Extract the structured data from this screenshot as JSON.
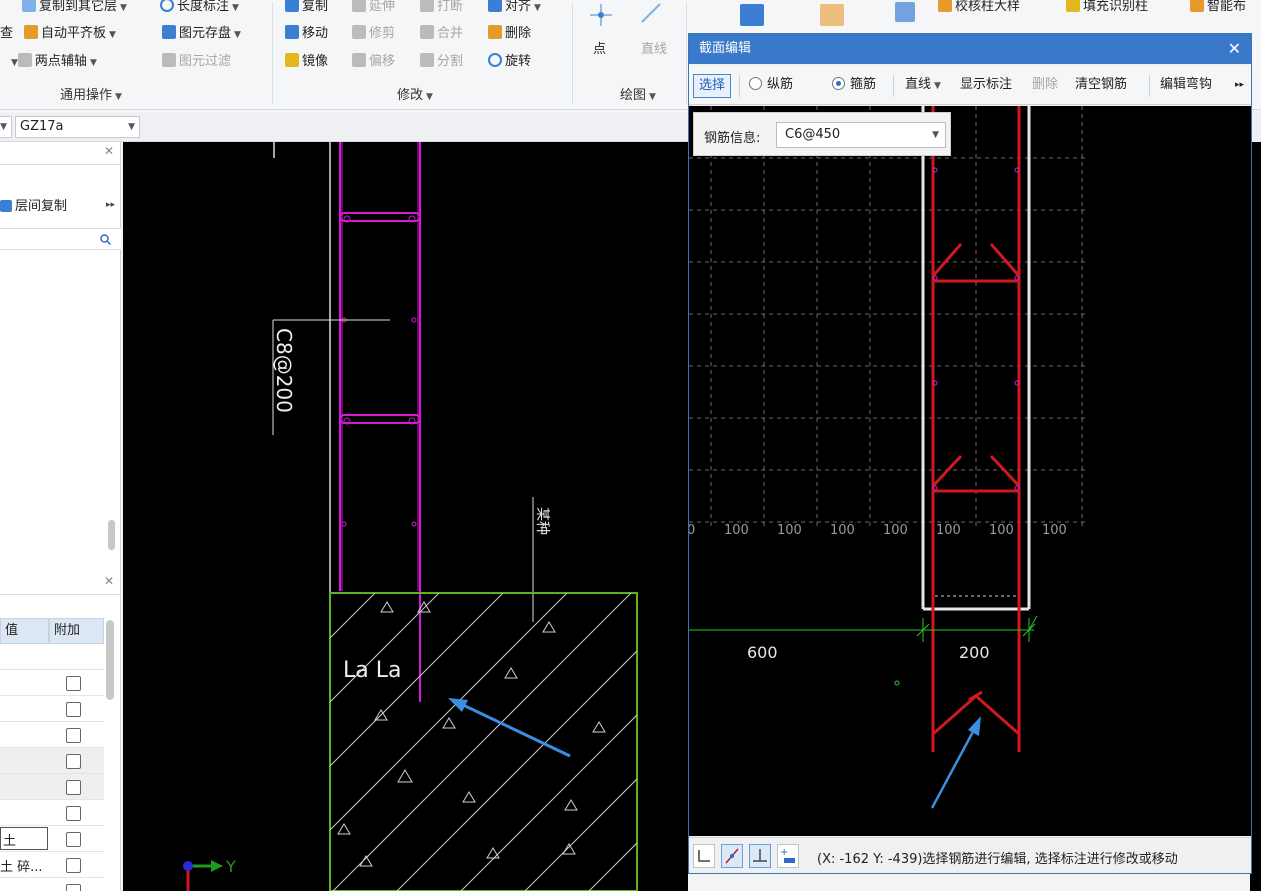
{
  "ribbon": {
    "items": {
      "copy_to_other_floors": "复制到其它层",
      "length_annotation": "长度标注",
      "copy": "复制",
      "extend": "延伸",
      "break": "打断",
      "align": "对齐",
      "check_column_detail": "校核柱大样",
      "fill_identify_column": "填充识别柱",
      "smart_layout": "智能布",
      "check": "查",
      "auto_flush_slab": "自动平齐板",
      "element_save": "图元存盘",
      "move": "移动",
      "trim": "修剪",
      "merge": "合并",
      "delete": "删除",
      "two_point_axis": "两点辅轴",
      "element_filter": "图元过滤",
      "mirror": "镜像",
      "offset": "偏移",
      "split": "分割",
      "rotate": "旋转",
      "point": "点",
      "line": "直线"
    },
    "groups": {
      "general": "通用操作",
      "modify": "修改",
      "draw": "绘图"
    }
  },
  "toolbar2": {
    "component_name": "GZ17a"
  },
  "left_top_panel": {
    "floor_copy": "层间复制"
  },
  "left_bottom_panel": {
    "col_value": "值",
    "col_extra": "附加",
    "cell_a": "土",
    "cell_b": "土 碎..."
  },
  "canvas": {
    "rebar_label": "C8@200",
    "dim_text": "La La",
    "side_text": "某种",
    "axis_y": "Y"
  },
  "dialog": {
    "title": "截面编辑",
    "toolbar": {
      "select": "选择",
      "longitudinal": "纵筋",
      "stirrup": "箍筋",
      "line": "直线",
      "show_annotation": "显示标注",
      "delete": "删除",
      "clear_rebar": "清空钢筋",
      "edit_hook": "编辑弯钩"
    },
    "rebar_info_label": "钢筋信息:",
    "rebar_info_value": "C6@450",
    "grid_labels": [
      "100",
      "100",
      "100",
      "100",
      "100",
      "100",
      "100"
    ],
    "dims": {
      "left": "600",
      "width": "200"
    },
    "status_text": "(X: -162 Y: -439)选择钢筋进行编辑, 选择标注进行修改或移动"
  },
  "colors": {
    "accent": "#3a78c9",
    "rebar_magenta": "#d21bd2",
    "stirrup_red": "#d0191e",
    "concrete_green": "#5eb31f",
    "annotation_arrow": "#3a8fe0"
  }
}
